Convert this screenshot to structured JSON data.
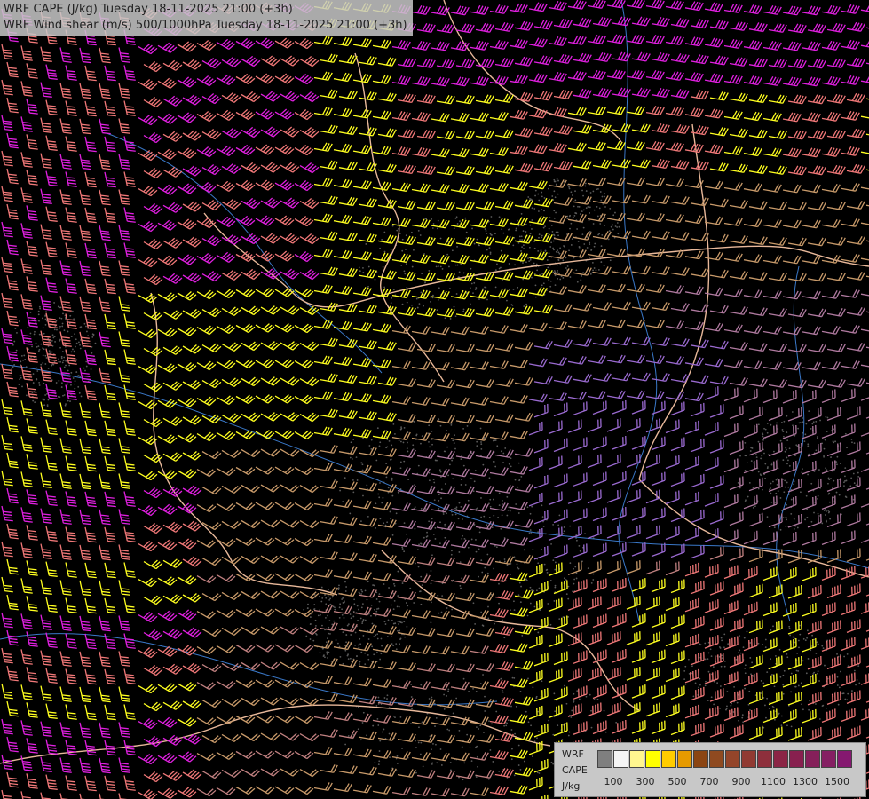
{
  "title": {
    "line1": "WRF CAPE (J/kg) Tuesday 18-11-2025 21:00 (+3h)",
    "line2": "WRF Wind shear (m/s) 500/1000hPa Tuesday 18-11-2025 21:00 (+3h)"
  },
  "legend": {
    "label_line1": "WRF",
    "label_line2": "CAPE",
    "label_line3": "J/kg",
    "colors": [
      "#7f7f7f",
      "#f5f5f5",
      "#fff68f",
      "#ffff00",
      "#ffcc00",
      "#e69a00",
      "#8b4513",
      "#8f4a20",
      "#94452a",
      "#913a32",
      "#8e2f3c",
      "#8b2545",
      "#88204f",
      "#85205a",
      "#851f63",
      "#851870"
    ],
    "tick_labels": [
      "100",
      "300",
      "500",
      "700",
      "900",
      "1100",
      "1300",
      "1500"
    ]
  },
  "map": {
    "background": "#000000",
    "barb_colors": {
      "magenta": "#e020e0",
      "salmon": "#f07878",
      "yellow": "#ffff20",
      "tan": "#c89a6a",
      "mauve": "#b07aa0",
      "purple": "#9a6ad0",
      "rose": "#c08080"
    },
    "border_color": "#e8b89a",
    "river_color": "#3a78c8"
  }
}
